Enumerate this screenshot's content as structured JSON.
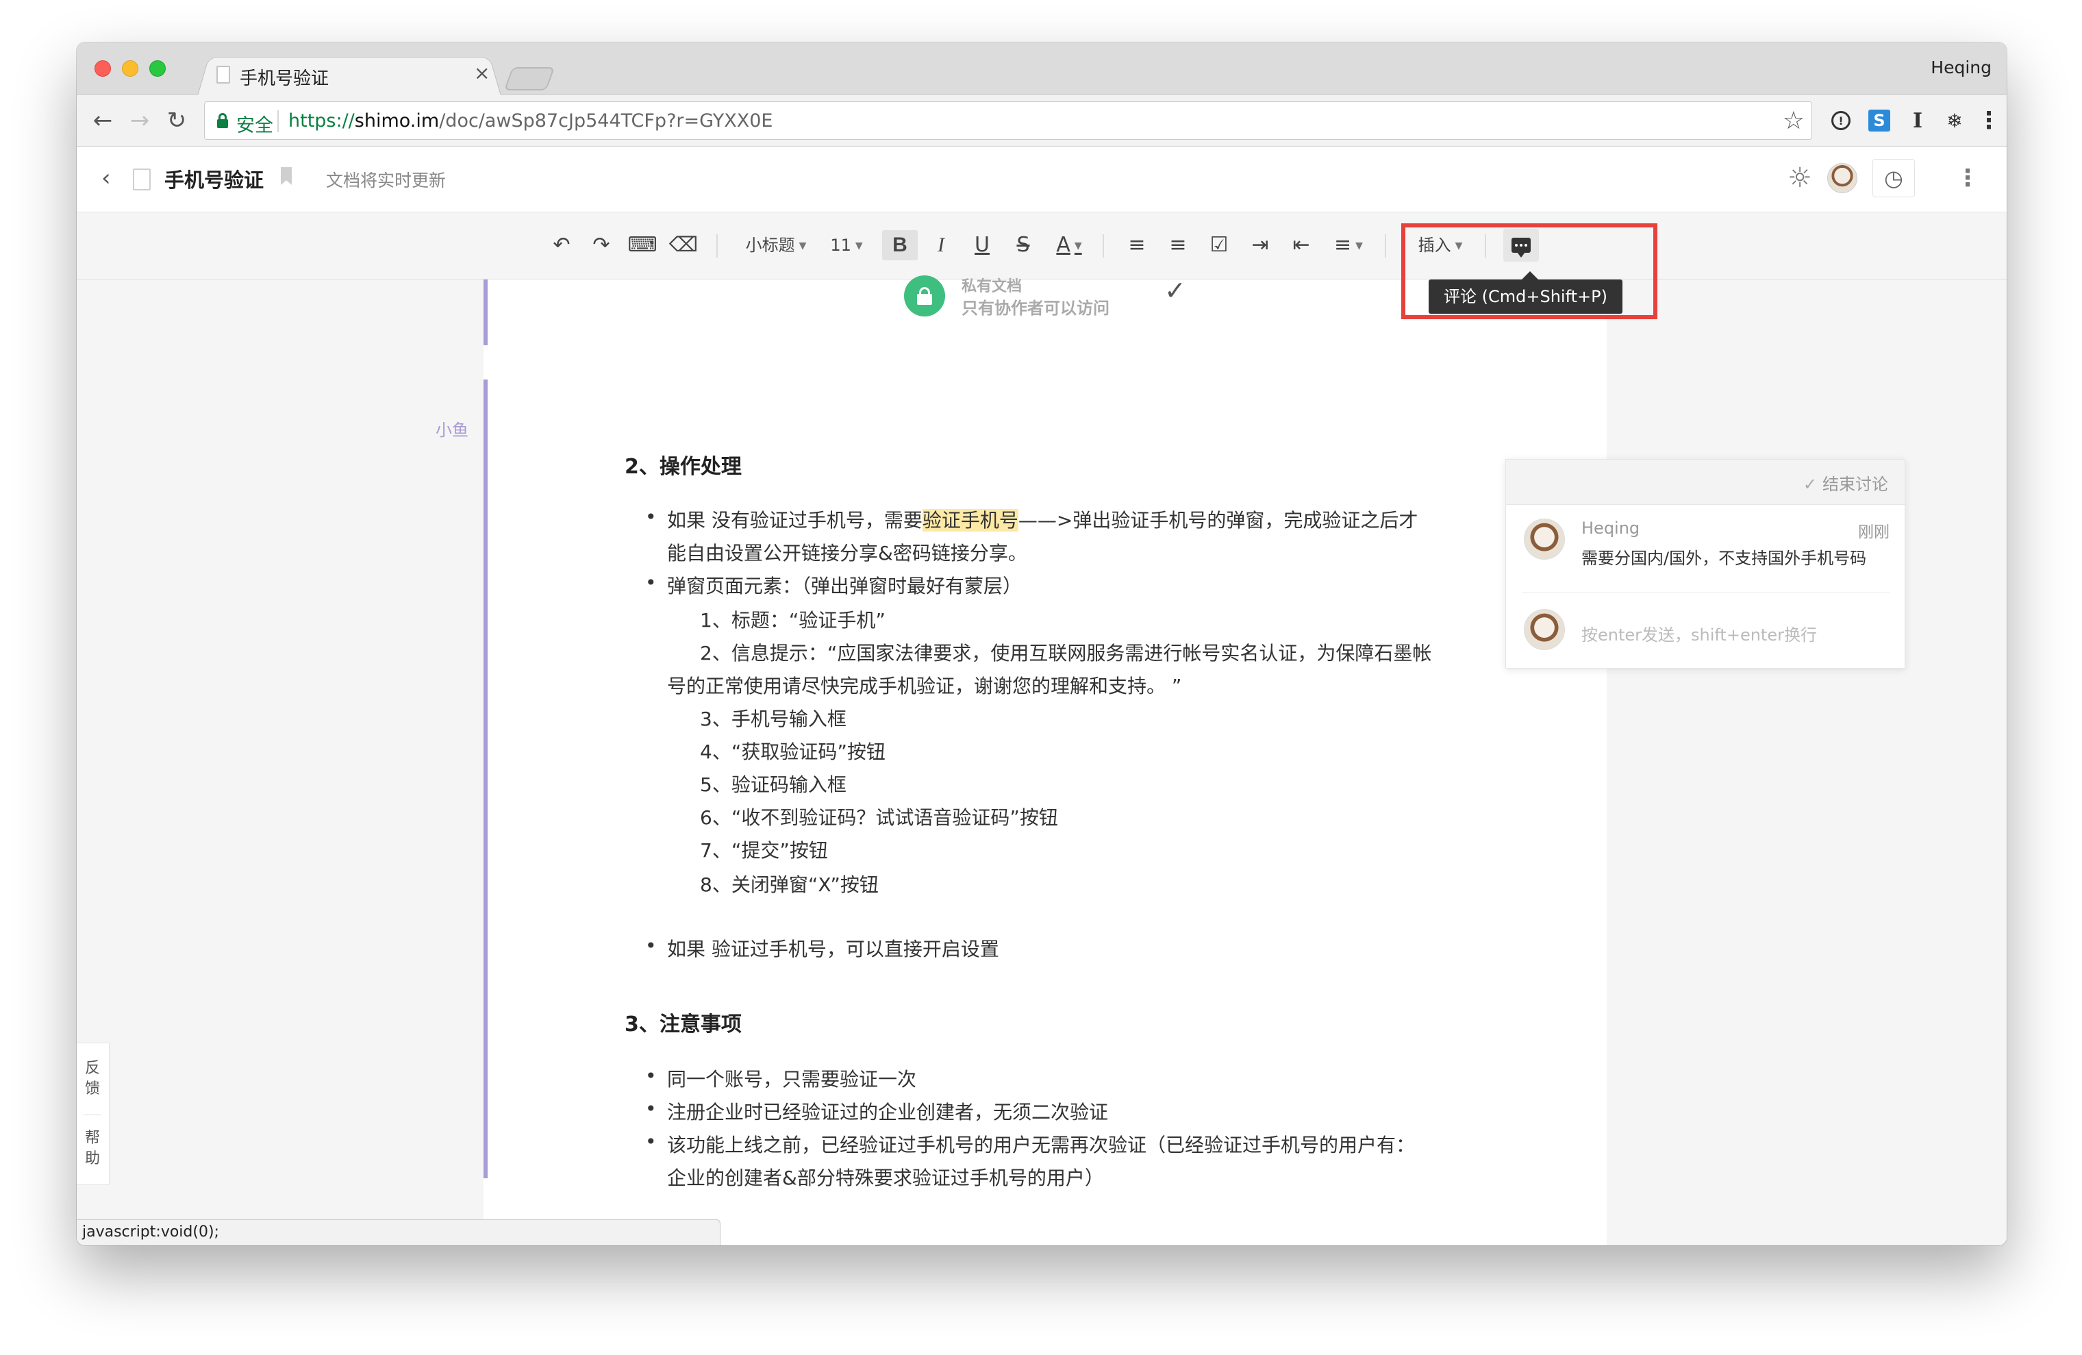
{
  "browser": {
    "tab_title": "手机号验证",
    "tab_close": "×",
    "profile_name": "Heqing",
    "secure_label": "安全",
    "url_scheme": "https://",
    "url_host": "shimo.im",
    "url_path": "/doc/awSp87cJp544TCFp?r=GYXX0E",
    "status_url": "javascript:void(0);"
  },
  "header": {
    "doc_title": "手机号验证",
    "save_status": "文档将实时更新"
  },
  "toolbar": {
    "heading_select": "小标题",
    "font_size": "11",
    "bold": "B",
    "italic": "I",
    "underline": "U",
    "strike": "S",
    "font_color": "A",
    "insert_label": "插入",
    "comment_tooltip": "评论 (Cmd+Shift+P)"
  },
  "privacy": {
    "title": "私有文档",
    "subtitle": "只有协作者可以访问"
  },
  "document": {
    "author_mark": "小鱼",
    "section2_title": "2、操作处理",
    "s2_b1_pre": "如果 没有验证过手机号，需要",
    "s2_b1_highlight": "验证手机号",
    "s2_b1_post": "——>弹出验证手机号的弹窗，完成验证之后才",
    "s2_b1_line2": "能自由设置公开链接分享&密码链接分享。",
    "s2_b2": "弹窗页面元素：（弹出弹窗时最好有蒙层）",
    "s2_items": [
      "1、标题：“验证手机”",
      "2、信息提示：“应国家法律要求，使用互联网服务需进行帐号实名认证，为保障石墨帐",
      "号的正常使用请尽快完成手机验证，谢谢您的理解和支持。 ”",
      "3、手机号输入框",
      "4、“获取验证码”按钮",
      "5、验证码输入框",
      "6、“收不到验证码？试试语音验证码”按钮",
      "7、“提交”按钮",
      "8、关闭弹窗“X”按钮"
    ],
    "s2_b3": "如果 验证过手机号，可以直接开启设置",
    "section3_title": "3、注意事项",
    "s3_items": [
      "同一个账号，只需要验证一次",
      "注册企业时已经验证过的企业创建者，无须二次验证",
      "该功能上线之前，已经验证过手机号的用户无需再次验证（已经验证过手机号的用户有：",
      "企业的创建者&部分特殊要求验证过手机号的用户）"
    ]
  },
  "comment": {
    "resolve_label": "结束讨论",
    "author": "Heqing",
    "time": "刚刚",
    "text": "需要分国内/国外，不支持国外手机号码",
    "input_placeholder": "按enter发送，shift+enter换行"
  },
  "side_tools": {
    "feedback": "反馈",
    "help": "帮助"
  }
}
